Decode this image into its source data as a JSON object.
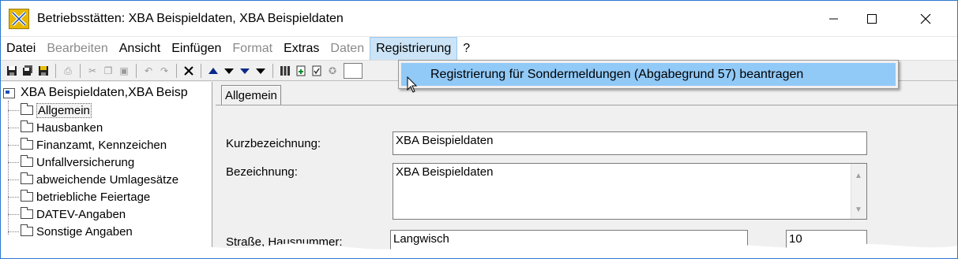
{
  "window": {
    "title": "Betriebsstätten: XBA Beispieldaten, XBA Beispieldaten",
    "controls": {
      "minimize": "—",
      "maximize": "☐",
      "close": "✕"
    }
  },
  "menubar": {
    "items": [
      {
        "label": "Datei",
        "enabled": true
      },
      {
        "label": "Bearbeiten",
        "enabled": false
      },
      {
        "label": "Ansicht",
        "enabled": true
      },
      {
        "label": "Einfügen",
        "enabled": true
      },
      {
        "label": "Format",
        "enabled": false
      },
      {
        "label": "Extras",
        "enabled": true
      },
      {
        "label": "Daten",
        "enabled": false
      },
      {
        "label": "Registrierung",
        "enabled": true,
        "active": true
      },
      {
        "label": "?",
        "enabled": true
      }
    ]
  },
  "dropdown": {
    "item": "Registrierung für Sondermeldungen (Abgabegrund 57) beantragen"
  },
  "toolbar": {
    "icons": [
      "save-icon",
      "save-all-icon",
      "save-close-icon",
      "print-icon",
      "cut-icon",
      "copy-icon",
      "paste-icon",
      "undo-icon",
      "redo-icon",
      "delete-icon",
      "nav-first-icon",
      "nav-prev-icon",
      "nav-next-icon",
      "nav-last-icon",
      "columns-icon",
      "document-add-icon",
      "checklist-icon",
      "stamp-icon"
    ]
  },
  "tree": {
    "root": "XBA Beispieldaten,XBA Beisp",
    "items": [
      "Allgemein",
      "Hausbanken",
      "Finanzamt, Kennzeichen",
      "Unfallversicherung",
      "abweichende Umlagesätze",
      "betriebliche Feiertage",
      "DATEV-Angaben",
      "Sonstige Angaben"
    ],
    "selected": 0
  },
  "content": {
    "tab": "Allgemein",
    "fields": {
      "kurz_label": "Kurzbezeichnung:",
      "kurz_value": "XBA Beispieldaten",
      "bez_label": "Bezeichnung:",
      "bez_value": "XBA Beispieldaten",
      "strasse_label": "Straße, Hausnummer:",
      "strasse_value": "Langwisch",
      "hausnr_value": "10"
    }
  },
  "colors": {
    "accent": "#2b78d0",
    "menu_active": "#cce4f7",
    "dropdown_highlight": "#91c9f7"
  }
}
